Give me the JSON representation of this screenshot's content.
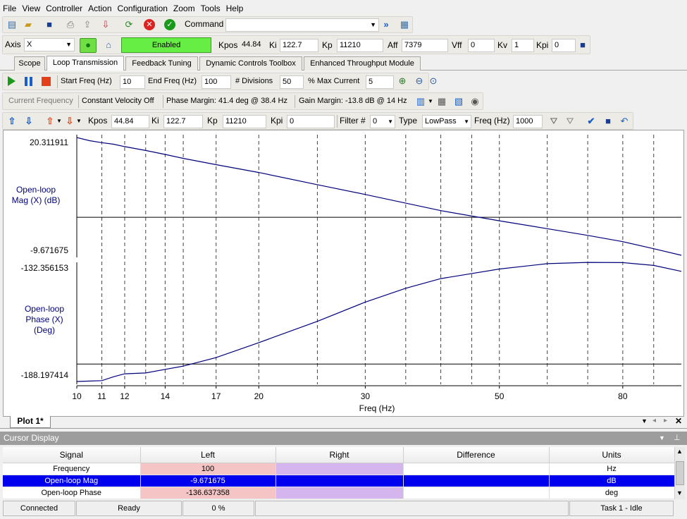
{
  "menu": [
    "File",
    "View",
    "Controller",
    "Action",
    "Configuration",
    "Zoom",
    "Tools",
    "Help"
  ],
  "toolbar1": {
    "command_label": "Command",
    "command_value": ""
  },
  "toolbar2": {
    "axis_label": "Axis",
    "axis_value": "X",
    "enabled_label": "Enabled",
    "fields": [
      {
        "label": "Kpos",
        "value": "44.84"
      },
      {
        "label": "Ki",
        "value": "122.7"
      },
      {
        "label": "Kp",
        "value": "11210"
      },
      {
        "label": "Aff",
        "value": "7379"
      },
      {
        "label": "Vff",
        "value": "0"
      },
      {
        "label": "Kv",
        "value": "1"
      },
      {
        "label": "Kpi",
        "value": "0"
      }
    ]
  },
  "tabs": [
    "Scope",
    "Loop Transmission",
    "Feedback Tuning",
    "Dynamic Controls Toolbox",
    "Enhanced Throughput Module"
  ],
  "active_tab": 1,
  "run_bar": {
    "start_label": "Start Freq (Hz)",
    "start_value": "10",
    "end_label": "End Freq (Hz)",
    "end_value": "100",
    "div_label": "# Divisions",
    "div_value": "50",
    "cur_label": "% Max Current",
    "cur_value": "5"
  },
  "info_bar": {
    "current_freq": "Current Frequency",
    "velocity": "Constant Velocity Off",
    "phase_margin": "Phase Margin: 41.4 deg @ 38.4 Hz",
    "gain_margin": "Gain Margin: -13.8 dB @ 14 Hz"
  },
  "filter_bar": {
    "kpos_label": "Kpos",
    "kpos_value": "44.84",
    "ki_label": "Ki",
    "ki_value": "122.7",
    "kp_label": "Kp",
    "kp_value": "11210",
    "kpi_label": "Kpi",
    "kpi_value": "0",
    "filter_label": "Filter #",
    "filter_value": "0",
    "type_label": "Type",
    "type_value": "LowPass",
    "freq_label": "Freq (Hz)",
    "freq_value": "1000"
  },
  "chart_data": [
    {
      "type": "line",
      "ylabel": "Open-loop Mag (X) (dB)",
      "ylim": [
        -9.671675,
        20.311911
      ],
      "ytick_labels": [
        "20.311911",
        "-9.671675"
      ],
      "x": [
        10,
        10.5,
        11,
        11.5,
        12,
        13,
        14,
        15,
        17,
        20,
        25,
        30,
        35,
        40,
        50,
        60,
        70,
        80,
        90,
        100
      ],
      "values": [
        20.3,
        19.5,
        19.0,
        18.6,
        18.0,
        17.0,
        16.0,
        15.0,
        13.4,
        11.4,
        8.3,
        5.8,
        3.6,
        1.7,
        -0.9,
        -2.9,
        -4.6,
        -6.2,
        -8.0,
        -9.67
      ],
      "reference_line": 0,
      "color": "#00007a"
    },
    {
      "type": "line",
      "ylabel": "Open-loop Phase (X) (Deg)",
      "ylim": [
        -188.197414,
        -132.356153
      ],
      "ytick_labels": [
        "-132.356153",
        "-188.197414"
      ],
      "x": [
        10,
        10.5,
        11,
        11.5,
        12,
        13,
        14,
        15,
        17,
        20,
        25,
        30,
        35,
        40,
        50,
        60,
        70,
        80,
        90,
        100
      ],
      "values": [
        -188.2,
        -188.0,
        -187.8,
        -186.0,
        -184.6,
        -184.2,
        -182.5,
        -181.0,
        -177.0,
        -170.0,
        -160.0,
        -151.0,
        -144.5,
        -140.0,
        -135.5,
        -133.0,
        -132.4,
        -132.5,
        -133.8,
        -136.6
      ],
      "reference_line": -180,
      "color": "#00007a"
    }
  ],
  "x_axis": {
    "label": "Freq (Hz)",
    "ticks": [
      "10",
      "11",
      "12",
      "14",
      "17",
      "20",
      "30",
      "50",
      "80"
    ],
    "xlim": [
      10,
      100
    ],
    "scale": "log",
    "grid": true
  },
  "plot_tab": "Plot 1*",
  "cursor_display": {
    "title": "Cursor Display",
    "columns": [
      "Signal",
      "Left",
      "Right",
      "Difference",
      "Units"
    ],
    "rows": [
      {
        "signal": "Frequency",
        "left": "100",
        "right": "",
        "diff": "",
        "units": "Hz"
      },
      {
        "signal": "Open-loop Mag",
        "left": "-9.671675",
        "right": "",
        "diff": "",
        "units": "dB"
      },
      {
        "signal": "Open-loop Phase",
        "left": "-136.637358",
        "right": "",
        "diff": "",
        "units": "deg"
      }
    ]
  },
  "status": {
    "connection": "Connected",
    "state": "Ready",
    "progress": "0 %",
    "task": "Task 1 - Idle"
  }
}
